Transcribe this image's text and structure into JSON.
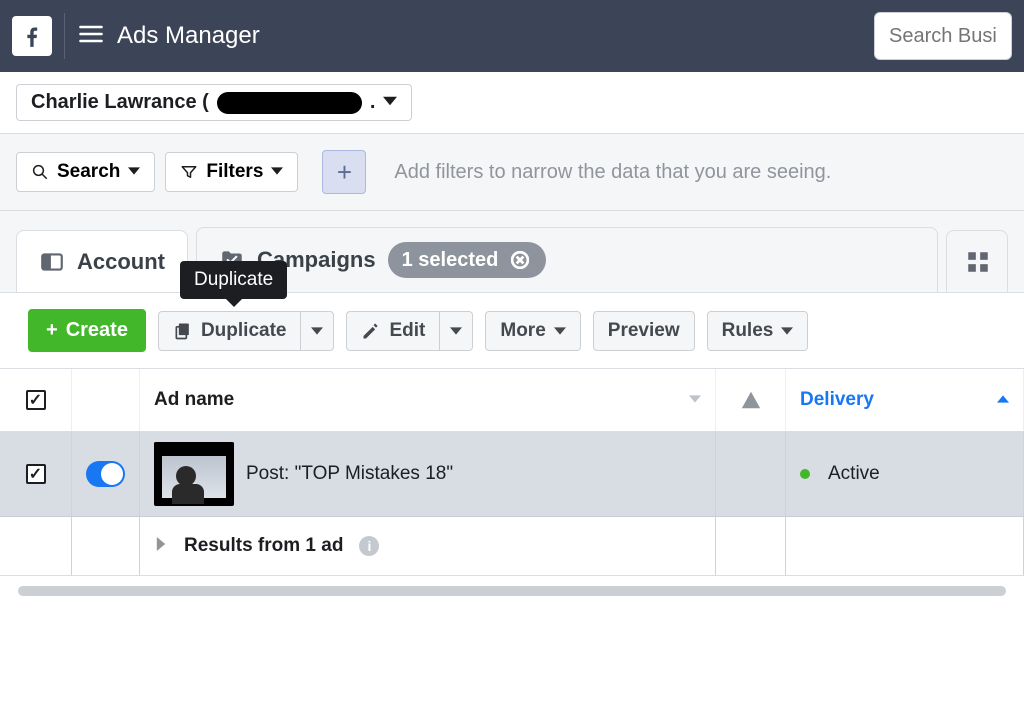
{
  "topnav": {
    "app_title": "Ads Manager",
    "search_placeholder": "Search Business"
  },
  "account": {
    "name_prefix": "Charlie Lawrance (",
    "name_suffix": "."
  },
  "filters": {
    "search_label": "Search",
    "filters_label": "Filters",
    "hint": "Add filters to narrow the data that you are seeing."
  },
  "tabs": {
    "account_label": "Account",
    "campaigns_label": "Campaigns",
    "selected_label": "1 selected"
  },
  "tooltip": {
    "duplicate": "Duplicate"
  },
  "toolbar": {
    "create_label": "Create",
    "duplicate_label": "Duplicate",
    "edit_label": "Edit",
    "more_label": "More",
    "preview_label": "Preview",
    "rules_label": "Rules"
  },
  "table": {
    "headers": {
      "ad_name": "Ad name",
      "delivery": "Delivery"
    },
    "rows": [
      {
        "name": "Post: \"TOP Mistakes 18\"",
        "delivery": "Active",
        "enabled": true,
        "checked": true
      }
    ],
    "footer_label": "Results from 1 ad"
  }
}
